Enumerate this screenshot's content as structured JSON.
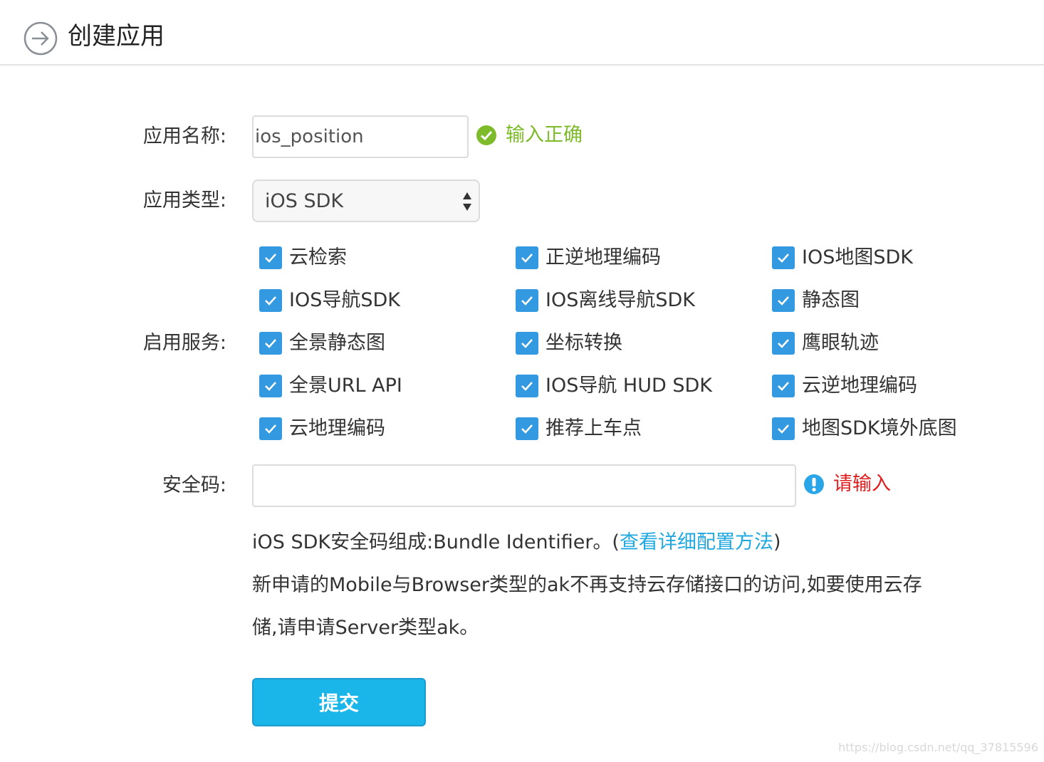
{
  "header": {
    "title": "创建应用",
    "back_icon": "arrow-right-circle-icon"
  },
  "form": {
    "app_name": {
      "label": "应用名称:",
      "value": "ios_position",
      "status": "输入正确",
      "status_icon": "check-circle-icon",
      "status_color": "#7dbb2a"
    },
    "app_type": {
      "label": "应用类型:",
      "selected": "iOS SDK"
    },
    "services": {
      "label": "启用服务:",
      "checkbox_color": "#3399e0",
      "items": [
        {
          "label": "云检索",
          "checked": true
        },
        {
          "label": "正逆地理编码",
          "checked": true
        },
        {
          "label": "IOS地图SDK",
          "checked": true
        },
        {
          "label": "IOS导航SDK",
          "checked": true
        },
        {
          "label": "IOS离线导航SDK",
          "checked": true
        },
        {
          "label": "静态图",
          "checked": true
        },
        {
          "label": "全景静态图",
          "checked": true
        },
        {
          "label": "坐标转换",
          "checked": true
        },
        {
          "label": "鹰眼轨迹",
          "checked": true
        },
        {
          "label": "全景URL API",
          "checked": true
        },
        {
          "label": "IOS导航 HUD SDK",
          "checked": true
        },
        {
          "label": "云逆地理编码",
          "checked": true
        },
        {
          "label": "云地理编码",
          "checked": true
        },
        {
          "label": "推荐上车点",
          "checked": true
        },
        {
          "label": "地图SDK境外底图",
          "checked": true
        }
      ]
    },
    "security_code": {
      "label": "安全码:",
      "value": "",
      "status": "请输入",
      "status_icon": "info-circle-icon",
      "status_color": "#e02020"
    },
    "notes": {
      "line1_prefix": "iOS SDK安全码组成:Bundle Identifier。(",
      "line1_link": "查看详细配置方法",
      "line1_suffix": ")",
      "line2": "新申请的Mobile与Browser类型的ak不再支持云存储接口的访问,如要使用云存",
      "line3": "储,请申请Server类型ak。"
    },
    "submit_label": "提交",
    "accent_color": "#1ab6ea"
  },
  "watermark": "https://blog.csdn.net/qq_37815596"
}
